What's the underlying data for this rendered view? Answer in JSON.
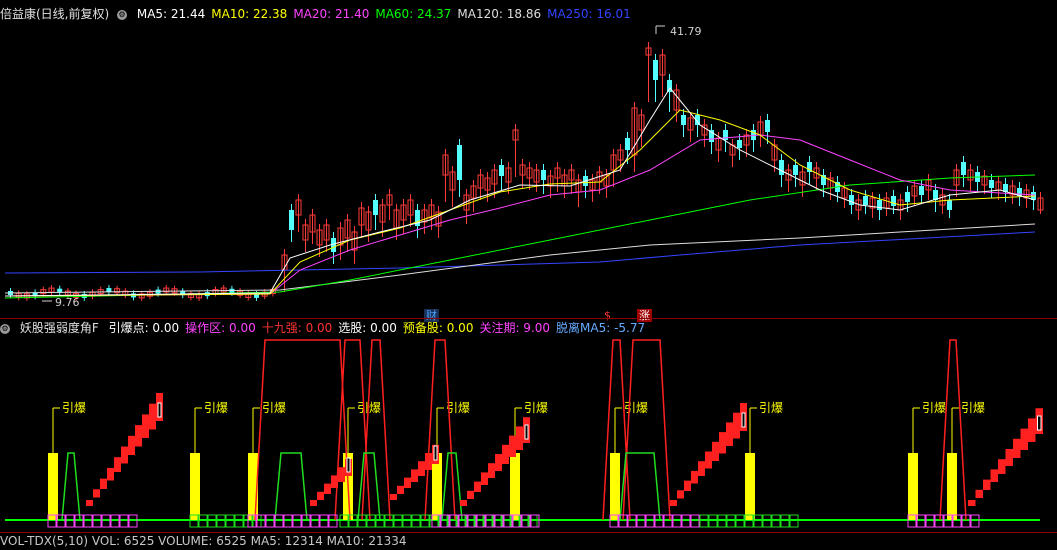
{
  "main_panel": {
    "title": "倍益康(日线,前复权)",
    "ma_items": [
      {
        "label": "MA5: 21.44",
        "color": "#ffffff"
      },
      {
        "label": "MA10: 22.38",
        "color": "#ffff00"
      },
      {
        "label": "MA20: 21.40",
        "color": "#ff44ff"
      },
      {
        "label": "MA60: 24.37",
        "color": "#00ff00"
      },
      {
        "label": "MA120: 18.86",
        "color": "#dddddd"
      },
      {
        "label": "MA250: 16.01",
        "color": "#3344ff"
      }
    ],
    "high_label": "41.79",
    "low_label": "9.76",
    "event_markers": [
      {
        "text": "财",
        "color": "#4aa3ff",
        "bg": "#1a2f55"
      },
      {
        "text": "$",
        "color": "#ff3333",
        "bg": "#000000"
      },
      {
        "text": "涨",
        "color": "#ffffff",
        "bg": "#a00000"
      }
    ]
  },
  "indicator_panel": {
    "title": "妖股强弱度角F",
    "items": [
      {
        "label": "引爆点: 0.00",
        "color": "#ffffff"
      },
      {
        "label": "操作区: 0.00",
        "color": "#ff44ff"
      },
      {
        "label": "十九强: 0.00",
        "color": "#ff3333"
      },
      {
        "label": "选股: 0.00",
        "color": "#ffffff"
      },
      {
        "label": "预备股: 0.00",
        "color": "#ffff00"
      },
      {
        "label": "关注期: 9.00",
        "color": "#ff44ff"
      },
      {
        "label": "脱离MA5: -5.77",
        "color": "#66aaff"
      }
    ],
    "signal_text": "引爆"
  },
  "bottom_panel": {
    "text": "VOL-TDX(5,10) VOL: 6525   VOLUME: 6525   MA5: 12314   MA10: 21334"
  },
  "colors": {
    "up": "#ff3b3b",
    "down": "#54ffff",
    "separator": "#8a0000",
    "green_base": "#00ff00",
    "signal_bar": "#ffff00"
  }
}
